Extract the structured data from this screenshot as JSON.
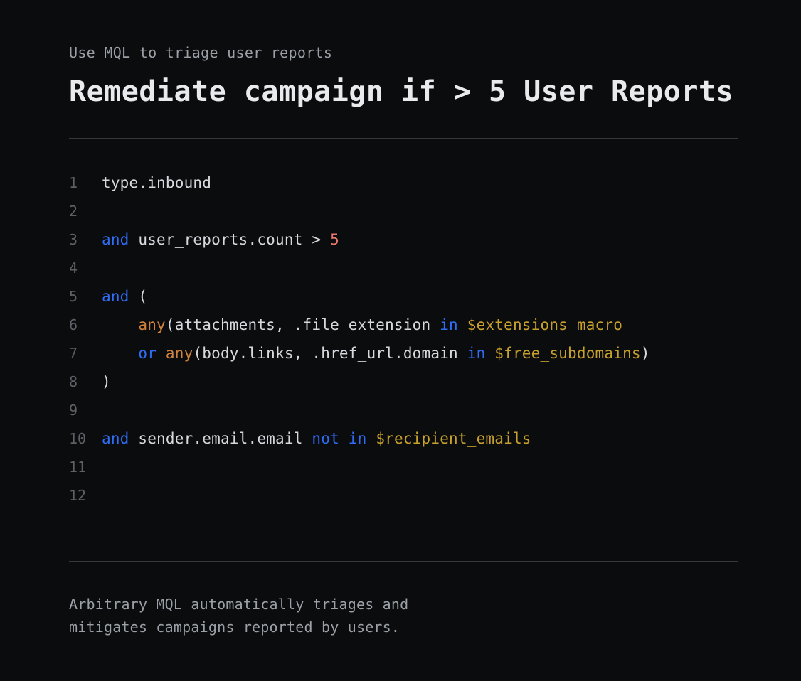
{
  "header": {
    "eyebrow": "Use MQL to triage user reports",
    "title": "Remediate campaign if > 5 User Reports"
  },
  "code": {
    "language": "MQL",
    "lines": [
      {
        "number": "1",
        "tokens": [
          {
            "t": "type.inbound",
            "c": "plain"
          }
        ]
      },
      {
        "number": "2",
        "tokens": []
      },
      {
        "number": "3",
        "tokens": [
          {
            "t": "and",
            "c": "kw"
          },
          {
            "t": " user_reports.count > ",
            "c": "plain"
          },
          {
            "t": "5",
            "c": "num"
          }
        ]
      },
      {
        "number": "4",
        "tokens": []
      },
      {
        "number": "5",
        "tokens": [
          {
            "t": "and",
            "c": "kw"
          },
          {
            "t": " (",
            "c": "plain"
          }
        ]
      },
      {
        "number": "6",
        "tokens": [
          {
            "t": "    ",
            "c": "plain"
          },
          {
            "t": "any",
            "c": "fn"
          },
          {
            "t": "(attachments, .file_extension ",
            "c": "plain"
          },
          {
            "t": "in",
            "c": "kw"
          },
          {
            "t": " ",
            "c": "plain"
          },
          {
            "t": "$extensions_macro",
            "c": "var"
          }
        ]
      },
      {
        "number": "7",
        "tokens": [
          {
            "t": "    ",
            "c": "plain"
          },
          {
            "t": "or",
            "c": "kw"
          },
          {
            "t": " ",
            "c": "plain"
          },
          {
            "t": "any",
            "c": "fn"
          },
          {
            "t": "(body.links, .href_url.domain ",
            "c": "plain"
          },
          {
            "t": "in",
            "c": "kw"
          },
          {
            "t": " ",
            "c": "plain"
          },
          {
            "t": "$free_subdomains",
            "c": "var"
          },
          {
            "t": ")",
            "c": "plain"
          }
        ]
      },
      {
        "number": "8",
        "tokens": [
          {
            "t": ")",
            "c": "plain"
          }
        ]
      },
      {
        "number": "9",
        "tokens": []
      },
      {
        "number": "10",
        "tokens": [
          {
            "t": "and",
            "c": "kw"
          },
          {
            "t": " sender.email.email ",
            "c": "plain"
          },
          {
            "t": "not",
            "c": "kw"
          },
          {
            "t": " ",
            "c": "plain"
          },
          {
            "t": "in",
            "c": "kw"
          },
          {
            "t": " ",
            "c": "plain"
          },
          {
            "t": "$recipient_emails",
            "c": "var"
          }
        ]
      },
      {
        "number": "11",
        "tokens": []
      },
      {
        "number": "12",
        "tokens": []
      }
    ]
  },
  "footer": {
    "description": "Arbitrary MQL automatically triages and\nmitigates campaigns reported by users."
  },
  "theme": {
    "background": "#0b0c0e",
    "text": "#d6d9dd",
    "muted": "#9ba0a6",
    "line_number": "#5d6166",
    "divider": "#34373b",
    "keyword": "#2f6df6",
    "function": "#d2833b",
    "number": "#e8766d",
    "variable": "#c8a02c"
  }
}
